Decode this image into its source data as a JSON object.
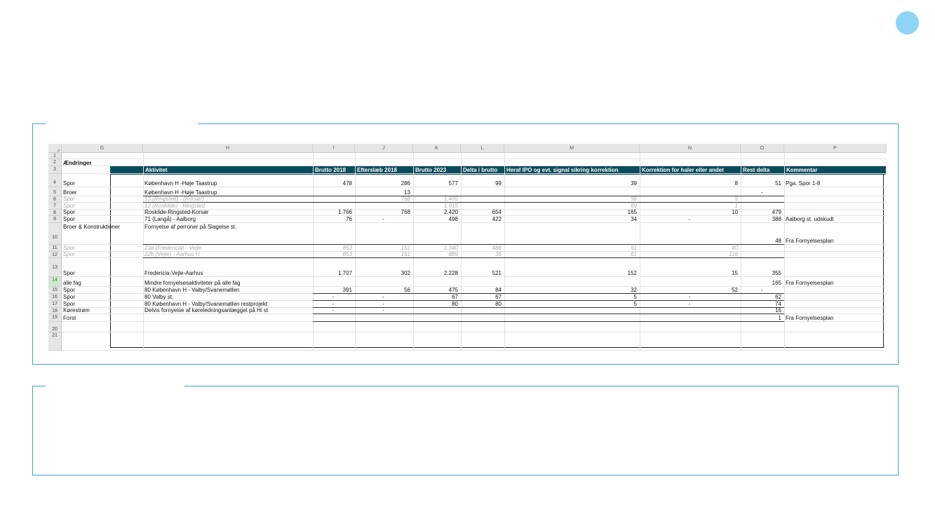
{
  "sheet": {
    "columns": [
      "G",
      "H",
      "I",
      "J",
      "K",
      "L",
      "M",
      "N",
      "O",
      "P"
    ],
    "row_numbers": [
      "1",
      "2",
      "3",
      "4",
      "5",
      "6",
      "7",
      "8",
      "9",
      "10",
      "11",
      "12",
      "13",
      "14",
      "15",
      "16",
      "17",
      "18",
      "19",
      "20",
      "21"
    ],
    "selected_row": "14",
    "section_title": "Ændringer",
    "headers": [
      "Fag",
      "Aktivitet",
      "Brutto 2018",
      "Efterslæb 2018",
      "Brutto 2023",
      "Delta i brutto",
      "Heraf IPO og evt. signal sikring korrektion",
      "Korrektion for haler eller andet",
      "Rest delta",
      "Kommentar"
    ],
    "rows": [
      {
        "row": "4",
        "cells": [
          "Spor",
          "København H -Høje Taastrup",
          "478",
          "286",
          "577",
          "99",
          "39",
          "8",
          "51",
          "Pga. Spor 1-8"
        ]
      },
      {
        "row": "5",
        "cells": [
          "Broer",
          "København H -Høje Taastrup",
          "",
          "13",
          "",
          "",
          "",
          "",
          "-",
          ""
        ]
      },
      {
        "row": "6",
        "cells": [
          "Spor",
          "13 (Ringsted) - (Korsør)",
          "",
          "768",
          "1.405",
          "",
          "96",
          "9",
          "",
          ""
        ],
        "muted": true
      },
      {
        "row": "7",
        "cells": [
          "Spor",
          "12 (Roskilde) - Ringsted",
          "",
          "-",
          "1.015",
          "",
          "69",
          "1",
          "",
          ""
        ],
        "muted": true
      },
      {
        "row": "8",
        "cells": [
          "Spor",
          "Roskilde-Ringsted-Korsør",
          "1.766",
          "768",
          "2.420",
          "654",
          "165",
          "10",
          "479",
          ""
        ]
      },
      {
        "row": "9",
        "cells": [
          "Spor",
          "71 (Langå) - Aalborg",
          "76",
          "-",
          "498",
          "422",
          "34",
          "-",
          "388",
          "Aalborg st. udskudt"
        ]
      },
      {
        "row": "10",
        "cells": [
          "Broer & Konstruktioner",
          "Fornyelse af perroner på Slagelse st.",
          "",
          "",
          "",
          "",
          "",
          "",
          "48",
          "Fra Fornyelsesplan"
        ]
      },
      {
        "row": "11",
        "cells": [
          "Spor",
          "23a (Fredericia) - Vejle",
          "853",
          "151",
          "1.340",
          "486",
          "91",
          "40",
          "",
          ""
        ],
        "muted": true
      },
      {
        "row": "12",
        "cells": [
          "Spor",
          "22b (Vejle) - Aarhus H",
          "853",
          "151",
          "889",
          "35",
          "61",
          "116",
          "",
          ""
        ],
        "muted": true
      },
      {
        "row": "13",
        "cells": [
          "Spor",
          "Fredericia-Vejle-Aarhus",
          "1.707",
          "302",
          "2.228",
          "521",
          "152",
          "15",
          "355",
          ""
        ]
      },
      {
        "row": "14",
        "cells": [
          "alle fag",
          "Mindre fornyelsesaktiviteter på alle fag",
          "",
          "",
          "",
          "",
          "",
          "",
          "165",
          "Fra Fornyelsesplan"
        ]
      },
      {
        "row": "15",
        "cells": [
          "Spor",
          "80 København H - Valby/Svanemøllen",
          "391",
          "56",
          "475",
          "84",
          "32",
          "52",
          "-",
          ""
        ]
      },
      {
        "row": "16",
        "cells": [
          "Spor",
          "80 Valby st.",
          "-",
          "-",
          "67",
          "67",
          "5",
          "-",
          "62",
          ""
        ]
      },
      {
        "row": "17",
        "cells": [
          "Spor",
          "80 København H - Valby/Svanemøllen restprojekt",
          "-",
          "-",
          "80",
          "80",
          "5",
          "-",
          "74",
          ""
        ]
      },
      {
        "row": "18",
        "cells": [
          "Kørestrøm",
          "Delvis fornyelse af køreledningsanlægget på Hi st",
          "-",
          "-",
          "",
          "",
          "",
          "",
          "16",
          ""
        ]
      },
      {
        "row": "19",
        "cells": [
          "Forst",
          "",
          "",
          "",
          "",
          "",
          "",
          "",
          "1",
          "Fra Fornyelsesplan"
        ]
      }
    ]
  }
}
